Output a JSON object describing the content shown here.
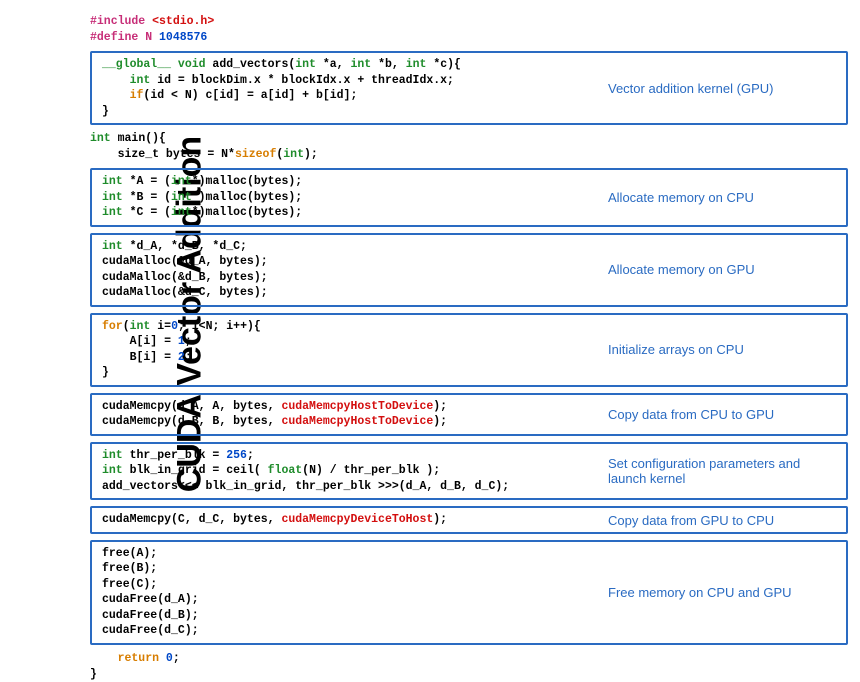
{
  "title": "CUDA Vector Addition",
  "headers": {
    "include_pre": "#include ",
    "include_lib": "<stdio.h>",
    "define_pre": "#define N ",
    "define_val": "1048576"
  },
  "kernel": {
    "label": "Vector addition kernel (GPU)",
    "l1_a": "__global__",
    "l1_b": " void",
    "l1_c": " add_vectors(",
    "l1_d": "int",
    "l1_e": " *a, ",
    "l1_f": "int",
    "l1_g": " *b, ",
    "l1_h": "int",
    "l1_i": " *c){",
    "l2_a": "    int",
    "l2_b": " id = blockDim.x * blockIdx.x + threadIdx.x;",
    "l3_a": "    if",
    "l3_b": "(id < N) c[id] = a[id] + b[id];",
    "l4": "}"
  },
  "main_sig": {
    "a": "int",
    "b": " main(){",
    "c": "    size_t bytes = N*",
    "d": "sizeof",
    "e": "(",
    "f": "int",
    "g": ");"
  },
  "alloc_cpu": {
    "label": "Allocate memory on CPU",
    "l1a": "int",
    "l1b": " *A = (",
    "l1c": "int",
    "l1d": "*)malloc(bytes);",
    "l2a": "int",
    "l2b": " *B = (",
    "l2c": "int",
    "l2d": "*)malloc(bytes);",
    "l3a": "int",
    "l3b": " *C = (",
    "l3c": "int",
    "l3d": "*)malloc(bytes);"
  },
  "alloc_gpu": {
    "label": "Allocate memory on GPU",
    "l1a": "int",
    "l1b": " *d_A, *d_B, *d_C;",
    "l2": "cudaMalloc(&d_A, bytes);",
    "l3": "cudaMalloc(&d_B, bytes);",
    "l4": "cudaMalloc(&d_C, bytes);"
  },
  "init_cpu": {
    "label": "Initialize arrays on CPU",
    "l1a": "for",
    "l1b": "(",
    "l1c": "int",
    "l1d": " i=",
    "l1e": "0",
    "l1f": "; i<N; i++){",
    "l2a": "    A[i] = ",
    "l2b": "1",
    "l2c": ";",
    "l3a": "    B[i] = ",
    "l3b": "2",
    "l3c": ";",
    "l4": "}"
  },
  "copy_h2d": {
    "label": "Copy data from CPU to GPU",
    "l1a": "cudaMemcpy(d_A, A, bytes, ",
    "l1b": "cudaMemcpyHostToDevice",
    "l1c": ");",
    "l2a": "cudaMemcpy(d_B, B, bytes, ",
    "l2b": "cudaMemcpyHostToDevice",
    "l2c": ");"
  },
  "launch": {
    "label": "Set configuration parameters and launch kernel",
    "l1a": "int",
    "l1b": " thr_per_blk = ",
    "l1c": "256",
    "l1d": ";",
    "l2a": "int",
    "l2b": " blk_in_grid = ceil( ",
    "l2c": "float",
    "l2d": "(N) / thr_per_blk );",
    "l3": "add_vectors<<< blk_in_grid, thr_per_blk >>>(d_A, d_B, d_C);"
  },
  "copy_d2h": {
    "label": "Copy data from GPU to CPU",
    "l1a": "cudaMemcpy(C, d_C, bytes, ",
    "l1b": "cudaMemcpyDeviceToHost",
    "l1c": ");"
  },
  "free_mem": {
    "label": "Free memory on CPU and GPU",
    "l1": "free(A);",
    "l2": "free(B);",
    "l3": "free(C);",
    "l4": "cudaFree(d_A);",
    "l5": "cudaFree(d_B);",
    "l6": "cudaFree(d_C);"
  },
  "ret": {
    "a": "    return ",
    "b": "0",
    "c": ";",
    "close": "}"
  }
}
